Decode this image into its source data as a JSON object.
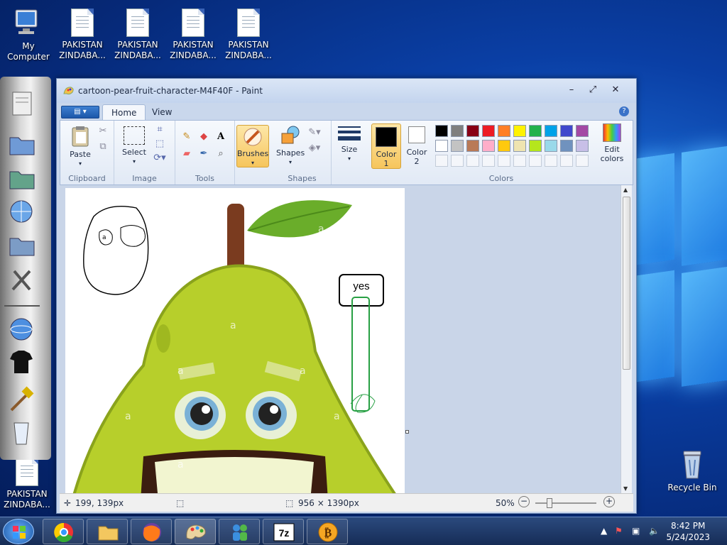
{
  "desktop": {
    "icons": [
      {
        "label": "My Computer"
      },
      {
        "label": "PAKISTAN ZINDABA..."
      },
      {
        "label": "PAKISTAN ZINDABA..."
      },
      {
        "label": "PAKISTAN ZINDABA..."
      },
      {
        "label": "PAKISTAN ZINDABA..."
      },
      {
        "label": "PAKISTAN ZINDABA..."
      },
      {
        "label": "Recycle Bin"
      }
    ]
  },
  "paint": {
    "title": "cartoon-pear-fruit-character-M4F40F - Paint",
    "tabs": [
      {
        "label": "Home"
      },
      {
        "label": "View"
      }
    ],
    "ribbon": {
      "groups": {
        "clipboard": "Clipboard",
        "image": "Image",
        "tools": "Tools",
        "shapes": "Shapes",
        "colors": "Colors"
      },
      "paste": "Paste",
      "select": "Select",
      "brushes": "Brushes",
      "shapes_btn": "Shapes",
      "size": "Size",
      "color1": "Color 1",
      "color2": "Color 2",
      "edit_colors": "Edit colors"
    },
    "palette": {
      "row1": [
        "#000000",
        "#7f7f7f",
        "#880015",
        "#ed1c24",
        "#ff7f27",
        "#fff200",
        "#22b14c",
        "#00a2e8",
        "#3f48cc",
        "#a349a4"
      ],
      "row2": [
        "#ffffff",
        "#c3c3c3",
        "#b97a57",
        "#ffaec9",
        "#ffc90e",
        "#efe4b0",
        "#b5e61d",
        "#99d9ea",
        "#7092be",
        "#c8bfe7"
      ]
    },
    "canvas": {
      "watermark": "a",
      "yes_text": "yes"
    },
    "status": {
      "cursor_pos": "199, 139px",
      "image_size": "956 × 1390px",
      "zoom": "50%"
    }
  },
  "taskbar": {
    "time": "8:42 PM",
    "date": "5/24/2023"
  }
}
